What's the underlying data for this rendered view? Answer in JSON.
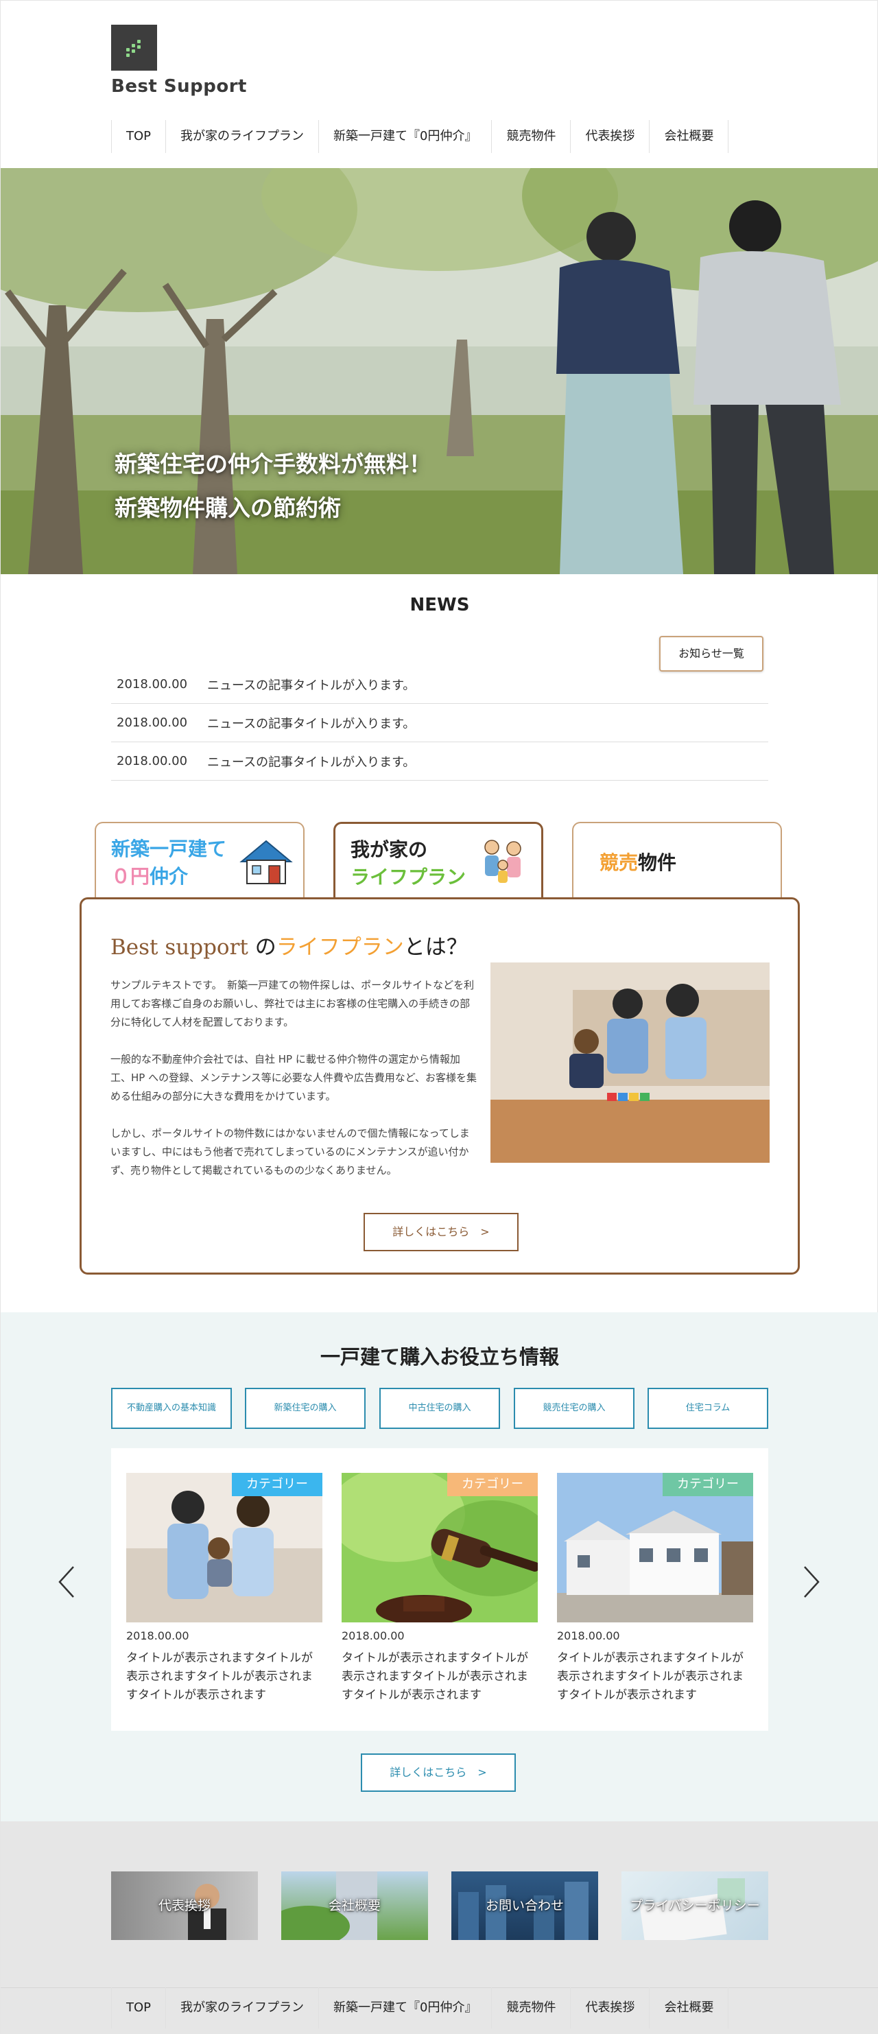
{
  "site": {
    "logo_text": "Best Support"
  },
  "nav": {
    "items": [
      "TOP",
      "我が家のライフプラン",
      "新築一戸建て『0円仲介』",
      "競売物件",
      "代表挨拶",
      "会社概要"
    ]
  },
  "hero": {
    "line1": "新築住宅の仲介手数料が無料！",
    "line2": "新築物件購入の節約術"
  },
  "news": {
    "title": "NEWS",
    "list_button": "お知らせ一覧",
    "items": [
      {
        "date": "2018.00.00",
        "title": "ニュースの記事タイトルが入ります。"
      },
      {
        "date": "2018.00.00",
        "title": "ニュースの記事タイトルが入ります。"
      },
      {
        "date": "2018.00.00",
        "title": "ニュースの記事タイトルが入ります。"
      }
    ]
  },
  "tabs": {
    "tab1": {
      "line1": "新築一戸建て",
      "line2a": "０円",
      "line2b": "仲介"
    },
    "tab2": {
      "line1": "我が家の",
      "line2": "ライフプラン"
    },
    "tab3": {
      "part1": "競売",
      "part2": "物件"
    }
  },
  "panel": {
    "title_a": "Best support",
    "title_b": " の",
    "title_c": "ライフプラン",
    "title_d": "とは？",
    "paragraphs": [
      "サンプルテキストです。　新築一戸建ての物件探しは、ポータルサイトなどを利用してお客様ご自身のお願いし、弊社では主にお客様の住宅購入の手続きの部分に特化して人材を配置しております。",
      "一般的な不動産仲介会社では、自社 HP に載せる仲介物件の選定から情報加工、HP への登録、メンテナンス等に必要な人件費や広告費用など、お客様を集める仕組みの部分に大きな費用をかけています。",
      "しかし、ポータルサイトの物件数にはかないませんので個た情報になってしまいますし、中にはもう他者で売れてしまっているのにメンテナンスが追い付かず、売り物件として掲載されているものの少なくありません。"
    ],
    "button": "詳しくはこちら　>"
  },
  "info": {
    "title": "一戸建て購入お役立ち情報",
    "categories": [
      "不動産購入の基本知識",
      "新築住宅の購入",
      "中古住宅の購入",
      "競売住宅の購入",
      "住宅コラム"
    ],
    "cards": [
      {
        "badge": "カテゴリー",
        "badge_color": "#3bb6ee",
        "date": "2018.00.00",
        "title": "タイトルが表示されますタイトルが表示されますタイトルが表示されますタイトルが表示されます"
      },
      {
        "badge": "カテゴリー",
        "badge_color": "#f7b878",
        "date": "2018.00.00",
        "title": "タイトルが表示されますタイトルが表示されますタイトルが表示されますタイトルが表示されます"
      },
      {
        "badge": "カテゴリー",
        "badge_color": "#6fc7a4",
        "date": "2018.00.00",
        "title": "タイトルが表示されますタイトルが表示されますタイトルが表示されますタイトルが表示されます"
      }
    ],
    "button": "詳しくはこちら　>"
  },
  "footer": {
    "banners": [
      "代表挨拶",
      "会社概要",
      "お問い合わせ",
      "プライバシーポリシー"
    ]
  },
  "colors": {
    "accent_brown": "#8a5a34",
    "accent_teal": "#2b8cae",
    "accent_orange": "#f3a033"
  }
}
